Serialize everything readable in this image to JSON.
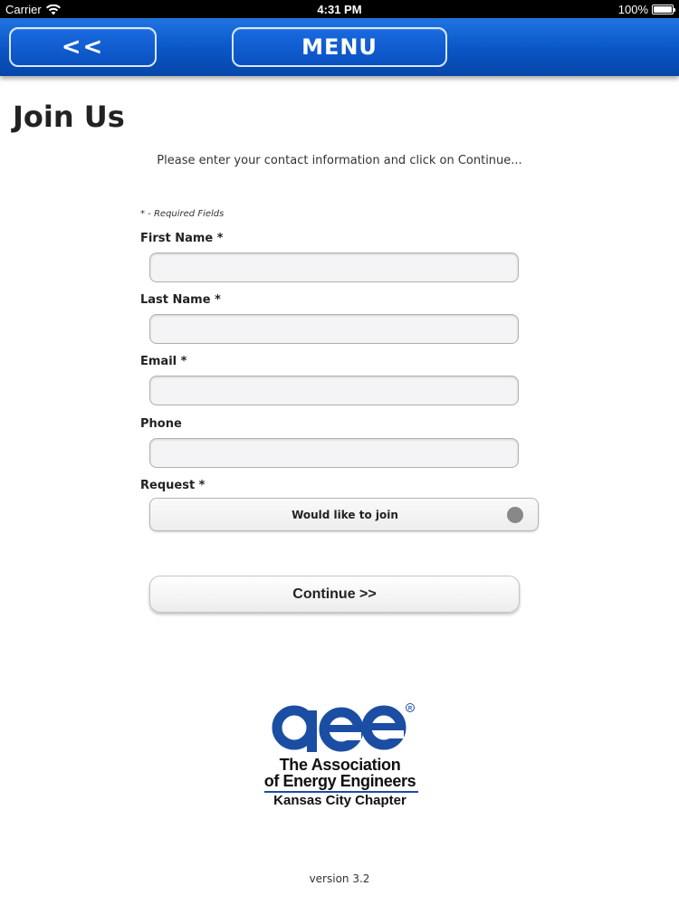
{
  "status_bar": {
    "carrier": "Carrier",
    "time": "4:31 PM",
    "battery": "100%"
  },
  "nav": {
    "back_label": "<<",
    "menu_label": "MENU"
  },
  "page": {
    "title": "Join Us",
    "instructions": "Please enter your contact information and click on Continue..."
  },
  "form": {
    "required_note": "* - Required Fields",
    "fields": [
      {
        "label": "First Name *",
        "value": ""
      },
      {
        "label": "Last Name *",
        "value": ""
      },
      {
        "label": "Email *",
        "value": ""
      },
      {
        "label": "Phone",
        "value": ""
      }
    ],
    "request": {
      "label": "Request *",
      "selected": "Would like to join"
    },
    "continue_label": "Continue >>"
  },
  "logo": {
    "wordmark": "aee",
    "line1": "The Association",
    "line2": "of Energy Engineers",
    "line3": "Kansas City Chapter"
  },
  "footer": {
    "version": "version 3.2"
  },
  "colors": {
    "nav_blue": "#0a55c6",
    "logo_blue": "#1b4ea3"
  }
}
